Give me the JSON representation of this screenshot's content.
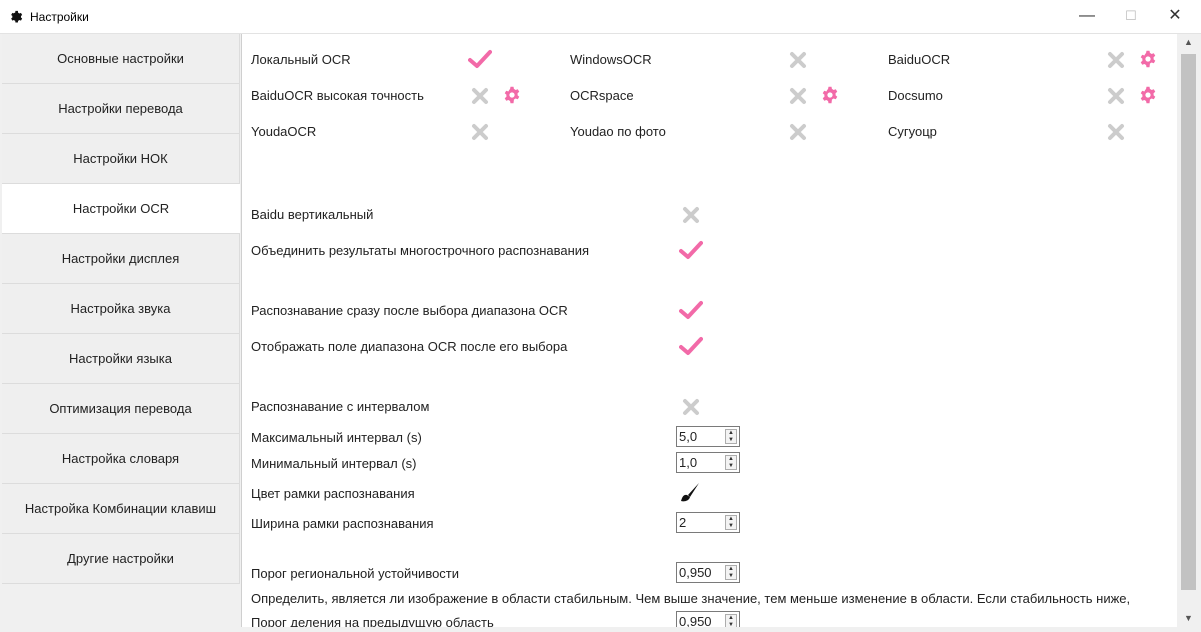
{
  "window": {
    "title": "Настройки",
    "minimize": "—",
    "maximize": "☐",
    "close": "✕"
  },
  "sidebar": {
    "items": [
      {
        "label": "Основные настройки"
      },
      {
        "label": "Настройки перевода"
      },
      {
        "label": "Настройки НОК"
      },
      {
        "label": "Настройки OCR",
        "active": true
      },
      {
        "label": "Настройки дисплея"
      },
      {
        "label": "Настройка звука"
      },
      {
        "label": "Настройки языка"
      },
      {
        "label": "Оптимизация перевода"
      },
      {
        "label": "Настройка словаря"
      },
      {
        "label": "Настройка Комбинации клавиш"
      },
      {
        "label": "Другие настройки"
      }
    ]
  },
  "ocr_engines": [
    {
      "label": "Локальный OCR",
      "enabled": true,
      "has_settings": false
    },
    {
      "label": "WindowsOCR",
      "enabled": false,
      "has_settings": false
    },
    {
      "label": "BaiduOCR",
      "enabled": false,
      "has_settings": true
    },
    {
      "label": "BaiduOCR высокая точность",
      "enabled": false,
      "has_settings": true
    },
    {
      "label": "OCRspace",
      "enabled": false,
      "has_settings": true
    },
    {
      "label": "Docsumo",
      "enabled": false,
      "has_settings": true
    },
    {
      "label": "YoudaOCR",
      "enabled": false,
      "has_settings": false
    },
    {
      "label": "Youdao по фото",
      "enabled": false,
      "has_settings": false
    },
    {
      "label": "Сугуоцр",
      "enabled": false,
      "has_settings": false
    }
  ],
  "options": {
    "baidu_vertical": {
      "label": "Baidu вертикальный",
      "enabled": false
    },
    "merge_multiline": {
      "label": "Объединить результаты многострочного распознавания",
      "enabled": true
    },
    "recognize_after_select": {
      "label": "Распознавание сразу после выбора диапазона OCR",
      "enabled": true
    },
    "show_range_box": {
      "label": "Отображать поле диапазона OCR после его выбора",
      "enabled": true
    },
    "interval_recognition": {
      "label": "Распознавание с интервалом",
      "enabled": false
    },
    "max_interval": {
      "label": "Максимальный интервал (s)",
      "value": "5,0"
    },
    "min_interval": {
      "label": "Минимальный интервал (s)",
      "value": "1,0"
    },
    "frame_color": {
      "label": "Цвет рамки распознавания"
    },
    "frame_width": {
      "label": "Ширина рамки распознавания",
      "value": "2"
    },
    "stability_threshold": {
      "label": "Порог региональной устойчивости",
      "value": "0,950"
    },
    "stability_desc": "Определить, является ли изображение в области стабильным. Чем выше значение, тем меньше изменение в области. Если стабильность ниже, ра",
    "split_threshold": {
      "label": "Порог деления на предыдущую область",
      "value": "0,950"
    }
  },
  "colors": {
    "accent": "#f26aa8",
    "disabled": "#cccccc"
  },
  "icons": {
    "enabled": "check-icon",
    "disabled": "cross-icon",
    "settings": "gear-icon",
    "color": "brush-icon"
  }
}
